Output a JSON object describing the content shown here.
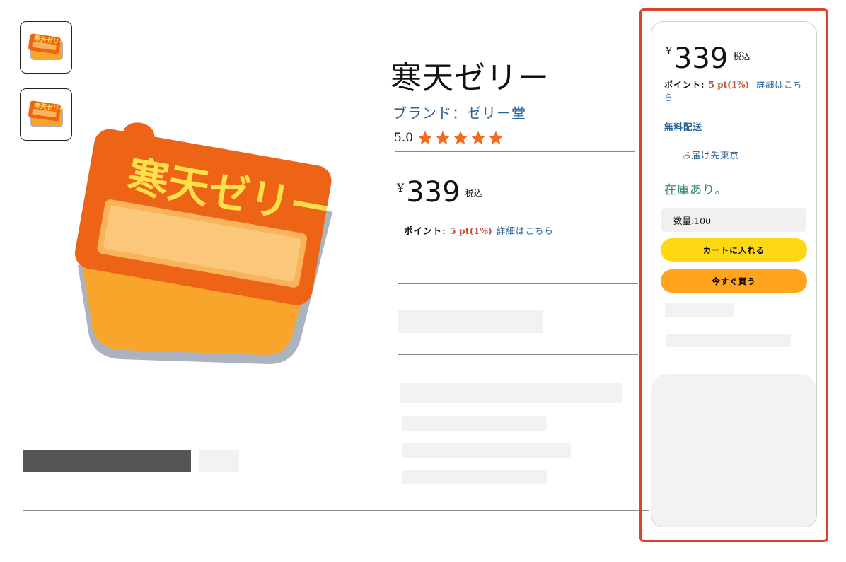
{
  "gallery": {
    "thumbnails": [
      {
        "icon": "jelly-pack-icon"
      },
      {
        "icon": "jelly-pack-icon"
      }
    ],
    "main_image": {
      "icon": "kanten-jelly-pack-illustration",
      "label_text": "寒天ゼリー"
    }
  },
  "product": {
    "title": "寒天ゼリー",
    "brand": "ブランド：ゼリー堂",
    "rating": "5.0",
    "rating_stars": 5,
    "star_color": "#f26b1d",
    "price_symbol": "¥",
    "price": "339",
    "tax_label": "税込",
    "points_label": "ポイント: ",
    "points_value": "5 pt(1%)",
    "points_link": "詳細はこちら"
  },
  "buybox": {
    "price_symbol": "¥",
    "price": "339",
    "tax_label": "税込",
    "points_label": "ポイント: ",
    "points_value": "5 pt(1%)",
    "points_link": "詳細はこちら",
    "free_shipping": "無料配送",
    "delivery": "お届け先東京",
    "stock": "在庫あり。",
    "quantity": "数量:100",
    "add_to_cart": "カートに入れる",
    "buy_now": "今すぐ買う"
  },
  "colors": {
    "highlight_border": "#d9442d",
    "cart_button": "#ffd814",
    "buy_button": "#ffa41c",
    "link": "#2a6496",
    "points_value": "#c0553a",
    "in_stock": "#2e8b6e"
  }
}
